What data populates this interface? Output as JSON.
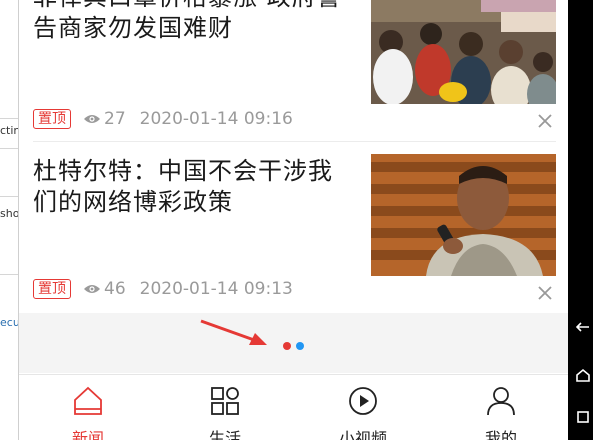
{
  "behind_window": {
    "fragments": [
      "ctin",
      "sho",
      "ecu"
    ]
  },
  "feed": [
    {
      "title": "菲律宾口罩价格暴涨 政府警告商家勿发国难财",
      "tag": "置顶",
      "views": "27",
      "time": "2020-01-14 09:16",
      "thumb": "crowd-photo"
    },
    {
      "title": "杜特尔特：中国不会干涉我们的网络博彩政策",
      "tag": "置顶",
      "views": "46",
      "time": "2020-01-14 09:13",
      "thumb": "duterte-portrait-photo"
    }
  ],
  "loading": {
    "dot_colors": [
      "#e53935",
      "#2196f3"
    ]
  },
  "annotation": {
    "arrow_color": "#e53935"
  },
  "tabbar": {
    "accent": "#e53935",
    "tabs": [
      {
        "label": "新闻",
        "icon": "home-icon",
        "active": true
      },
      {
        "label": "生活",
        "icon": "grid-icon",
        "active": false
      },
      {
        "label": "小视频",
        "icon": "play-icon",
        "active": false
      },
      {
        "label": "我的",
        "icon": "user-icon",
        "active": false
      }
    ]
  }
}
